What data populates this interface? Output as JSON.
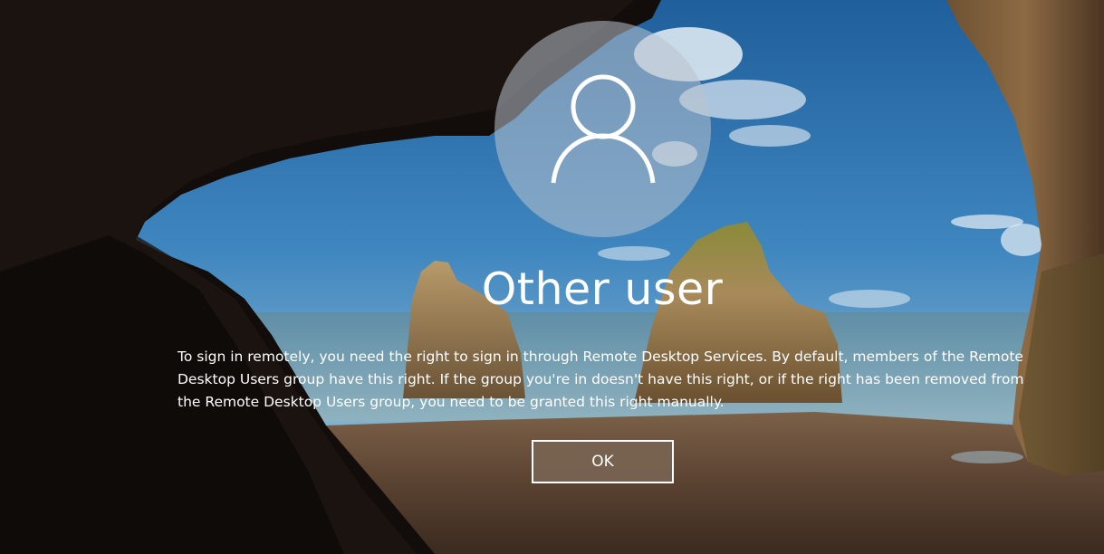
{
  "lock_screen": {
    "user_icon": "user-icon",
    "username": "Other user",
    "message": "To sign in remotely, you need the right to sign in through Remote Desktop Services. By default, members of the Remote Desktop Users group have this right. If the group you're in doesn't have this right, or if the right has been removed from the Remote Desktop Users group, you need to be granted this right manually.",
    "ok_label": "OK",
    "wallpaper": "sea-cave-beach-wallpaper"
  },
  "colors": {
    "text": "#ffffff",
    "avatar_fill": "#b9c3cd",
    "button_fill": "#786452",
    "button_border": "#ffffff"
  }
}
